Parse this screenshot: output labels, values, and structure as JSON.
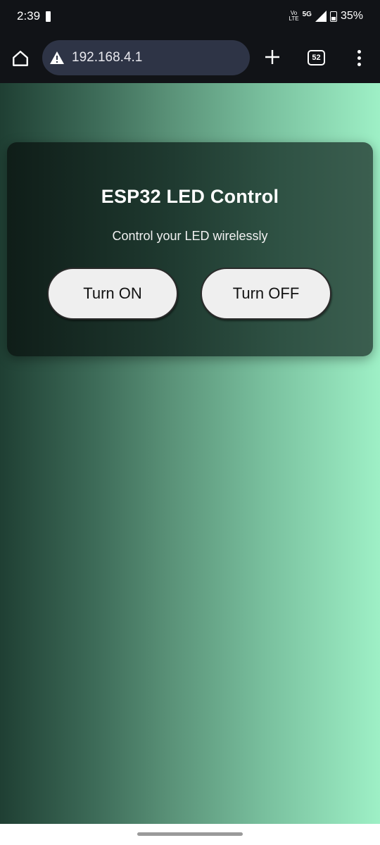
{
  "status_bar": {
    "time": "2:39",
    "volte_label_top": "Vo",
    "volte_label_bottom": "LTE",
    "network_type": "5G",
    "battery_percent": "35%",
    "battery_level": 0.35
  },
  "browser": {
    "url": "192.168.4.1",
    "tab_count": "52",
    "icons": {
      "home": "home-icon",
      "security": "warning-triangle-icon",
      "new_tab": "plus-icon",
      "menu": "more-vert-icon"
    }
  },
  "card": {
    "title": "ESP32 LED Control",
    "subtitle": "Control your LED wirelessly",
    "on_label": "Turn ON",
    "off_label": "Turn OFF"
  },
  "colors": {
    "gradient_start": "#1f3f33",
    "gradient_end": "#9ef0c6",
    "card_start": "#0f1d18",
    "card_end": "#3b5e4f",
    "button_bg": "#efefef",
    "chrome_bg": "#111317",
    "url_bg": "#2e3446"
  }
}
